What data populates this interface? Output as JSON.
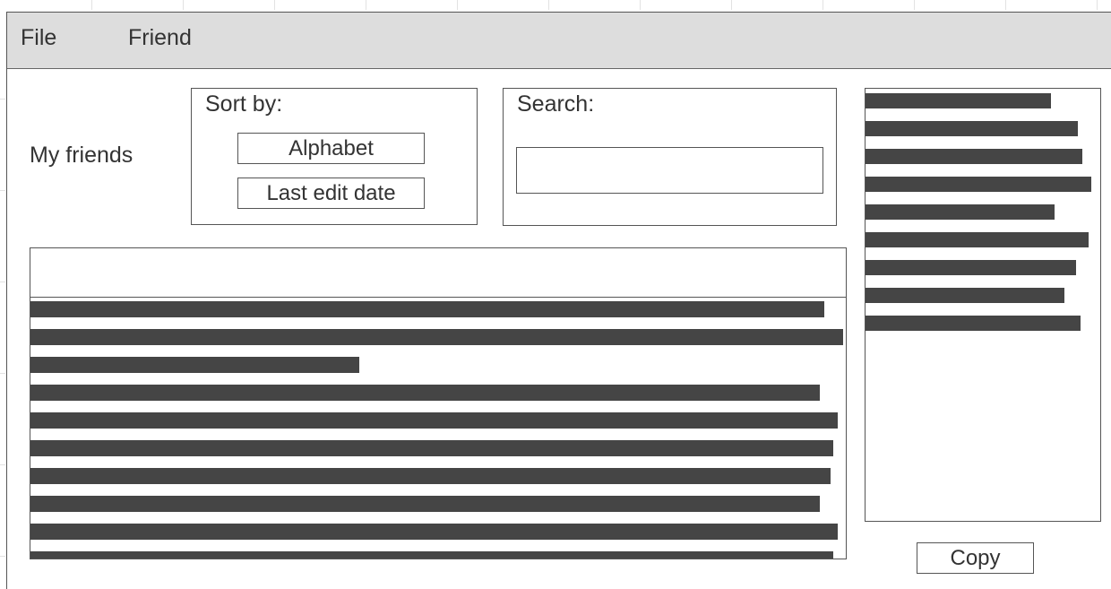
{
  "menu": {
    "items": [
      {
        "label": "File"
      },
      {
        "label": "Friend"
      }
    ]
  },
  "header": {
    "title": "My friends"
  },
  "sort": {
    "label": "Sort by:",
    "options": [
      {
        "label": "Alphabet"
      },
      {
        "label": "Last edit date"
      }
    ]
  },
  "search": {
    "label": "Search:",
    "value": "",
    "placeholder": ""
  },
  "actions": {
    "copy_label": "Copy"
  }
}
